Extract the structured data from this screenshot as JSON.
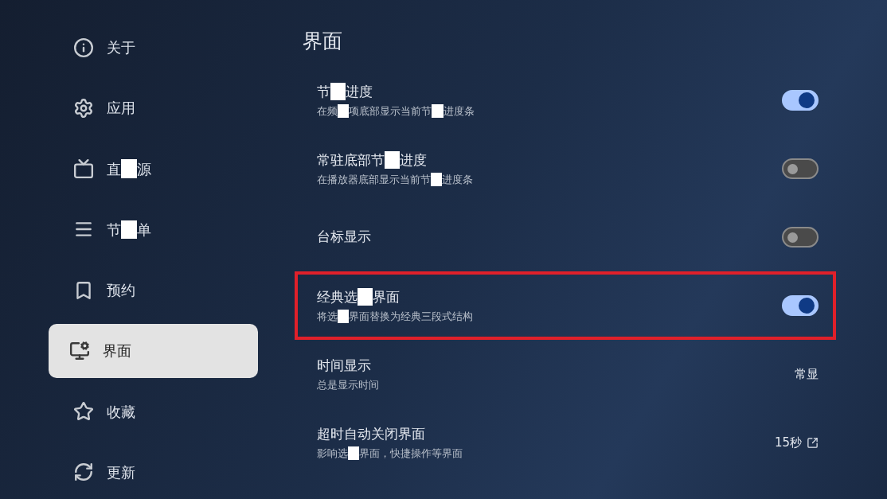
{
  "sidebar": {
    "items": [
      {
        "kind": "info",
        "label": [
          "关于"
        ],
        "selected": false
      },
      {
        "kind": "gear",
        "label": [
          "应用"
        ],
        "selected": false
      },
      {
        "kind": "tv",
        "label": [
          "直",
          "源"
        ],
        "selected": false
      },
      {
        "kind": "list",
        "label": [
          "节",
          "单"
        ],
        "selected": false
      },
      {
        "kind": "bookmark",
        "label": [
          "预约"
        ],
        "selected": false
      },
      {
        "kind": "monitor",
        "label": [
          "界面"
        ],
        "selected": true
      },
      {
        "kind": "star",
        "label": [
          "收藏"
        ],
        "selected": false
      },
      {
        "kind": "refresh",
        "label": [
          "更新"
        ],
        "selected": false
      }
    ]
  },
  "page": {
    "title": "界面",
    "rows": [
      {
        "kind": "toggle",
        "title": [
          "节",
          "进度"
        ],
        "subtitle": [
          "在频",
          "项底部显示当前节",
          "进度条"
        ],
        "on": true,
        "highlighted": false
      },
      {
        "kind": "toggle",
        "title": [
          "常驻底部节",
          "进度"
        ],
        "subtitle": [
          "在播放器底部显示当前节",
          "进度条"
        ],
        "on": false,
        "highlighted": false
      },
      {
        "kind": "toggle",
        "title": [
          "台标显示"
        ],
        "on": false,
        "highlighted": false
      },
      {
        "kind": "toggle",
        "title": [
          "经典选",
          "界面"
        ],
        "subtitle": [
          "将选",
          "界面替换为经典三段式结构"
        ],
        "on": true,
        "highlighted": true
      },
      {
        "kind": "value",
        "title": [
          "时间显示"
        ],
        "subtitle": [
          "总是显示时间"
        ],
        "value": "常显",
        "external": false,
        "highlighted": false
      },
      {
        "kind": "value",
        "title": [
          "超时自动关闭界面"
        ],
        "subtitle": [
          "影响选",
          "界面，快捷操作等界面"
        ],
        "value": "15秒",
        "external": true,
        "highlighted": false
      }
    ]
  }
}
